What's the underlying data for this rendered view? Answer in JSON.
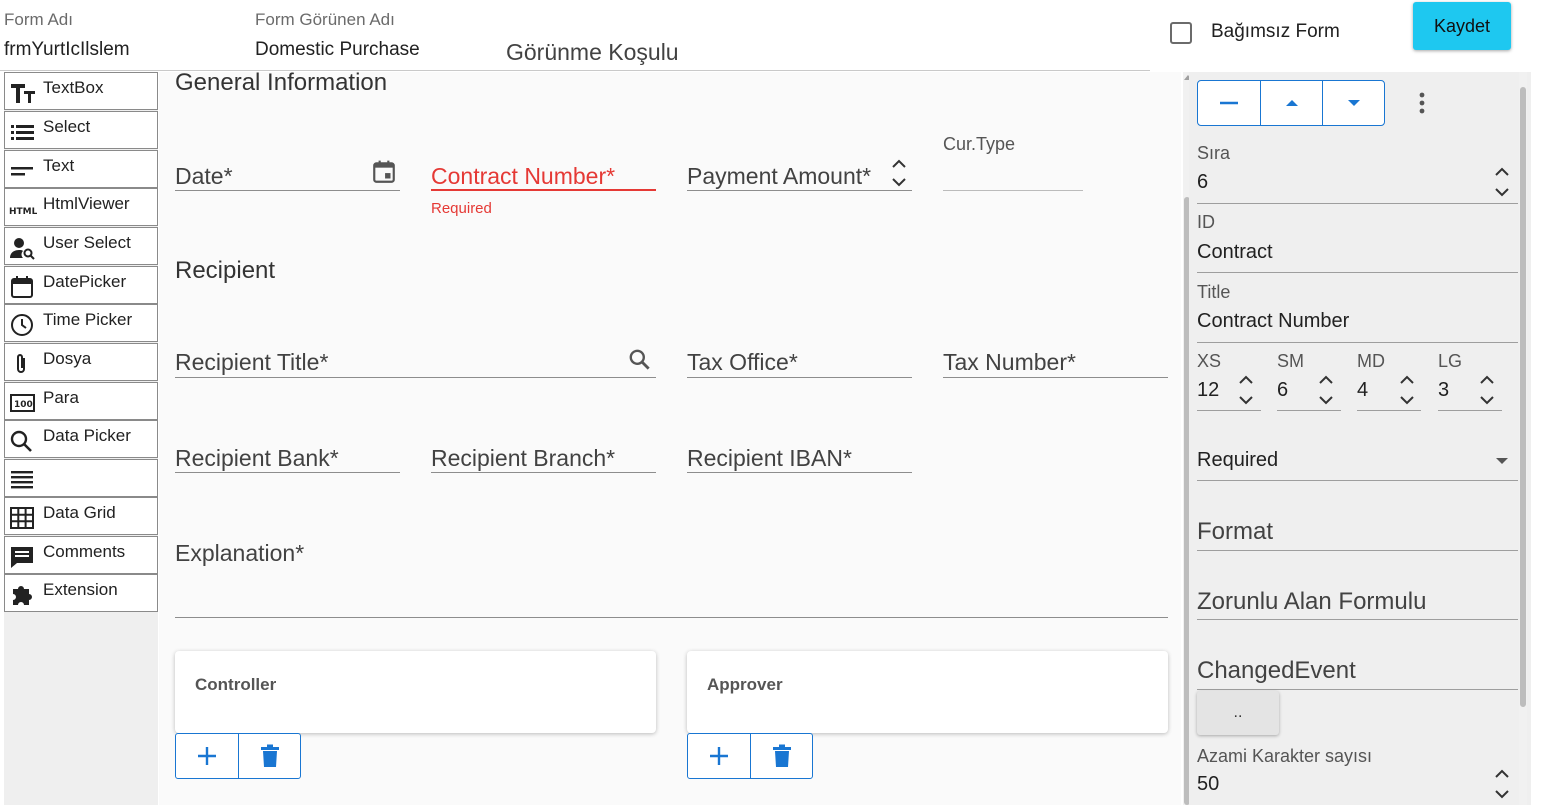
{
  "header": {
    "form_name_label": "Form Adı",
    "form_name_value": "frmYurtIcIlslem",
    "form_display_label": "Form Görünen Adı",
    "form_display_value": "Domestic Purchase",
    "visibility_condition_label": "Görünme Koşulu",
    "independent_form_label": "Bağımsız Form",
    "independent_form_checked": false,
    "save_label": "Kaydet",
    "save_color": "#1ec8f0"
  },
  "toolbox": {
    "items": [
      {
        "label": "TextBox",
        "icon": "text-format-icon"
      },
      {
        "label": "Select",
        "icon": "list-icon"
      },
      {
        "label": "Text",
        "icon": "short-text-icon"
      },
      {
        "label": "HtmlViewer",
        "icon": "html-icon"
      },
      {
        "label": "User Select",
        "icon": "user-search-icon"
      },
      {
        "label": "DatePicker",
        "icon": "calendar-icon"
      },
      {
        "label": "Time Picker",
        "icon": "clock-icon"
      },
      {
        "label": "Dosya",
        "icon": "paperclip-icon"
      },
      {
        "label": "Para",
        "icon": "counter-icon"
      },
      {
        "label": "Data Picker",
        "icon": "search-icon"
      },
      {
        "label": "",
        "icon": "subject-icon"
      },
      {
        "label": "Data Grid",
        "icon": "grid-icon"
      },
      {
        "label": "Comments",
        "icon": "comment-icon"
      },
      {
        "label": "Extension",
        "icon": "puzzle-icon"
      }
    ]
  },
  "canvas": {
    "general_title": "General Information",
    "date_label": "Date*",
    "contract_label": "Contract Number*",
    "contract_error": "Required",
    "payment_label": "Payment Amount*",
    "cur_type_label": "Cur.Type",
    "recipient_title": "Recipient",
    "recipient_title_label": "Recipient Title*",
    "tax_office_label": "Tax Office*",
    "tax_number_label": "Tax Number*",
    "recipient_bank_label": "Recipient Bank*",
    "recipient_branch_label": "Recipient Branch*",
    "recipient_iban_label": "Recipient IBAN*",
    "explanation_label": "Explanation*",
    "controller_title": "Controller",
    "approver_title": "Approver",
    "error_color": "#e53935",
    "accent_color": "#1976d2"
  },
  "properties": {
    "order_label": "Sıra",
    "order_value": "6",
    "id_label": "ID",
    "id_value": "Contract",
    "title_label": "Title",
    "title_value": "Contract Number",
    "xs_label": "XS",
    "xs_value": "12",
    "sm_label": "SM",
    "sm_value": "6",
    "md_label": "MD",
    "md_value": "4",
    "lg_label": "LG",
    "lg_value": "3",
    "required_select_value": "Required",
    "format_placeholder": "Format",
    "mandatory_formula_placeholder": "Zorunlu Alan Formulu",
    "changed_event_placeholder": "ChangedEvent",
    "ellipsis_button": "..",
    "max_chars_label": "Azami Karakter sayısı",
    "max_chars_value": "50"
  }
}
